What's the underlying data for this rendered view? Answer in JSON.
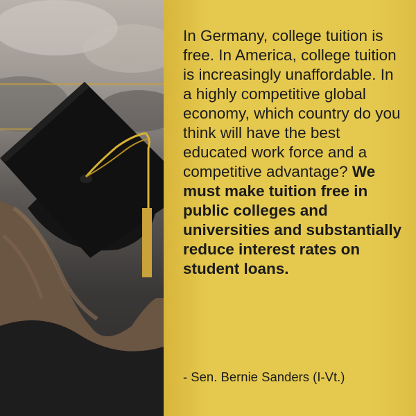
{
  "quote": {
    "regular_text": "In Germany, college tuition is free.  In America, college tuition is increasingly unaffordable. In a highly competitive global economy, which country do you think will have the best educated work force and a competitive advantage?",
    "bold_text": "We must make tuition free in public colleges and universities and substantially reduce interest rates on student loans."
  },
  "attribution": "- Sen. Bernie Sanders (I-Vt.)",
  "colors": {
    "panel": "#e5c94f",
    "text": "#1b1b1b",
    "cap": "#111111",
    "tassel": "#d8b232"
  }
}
